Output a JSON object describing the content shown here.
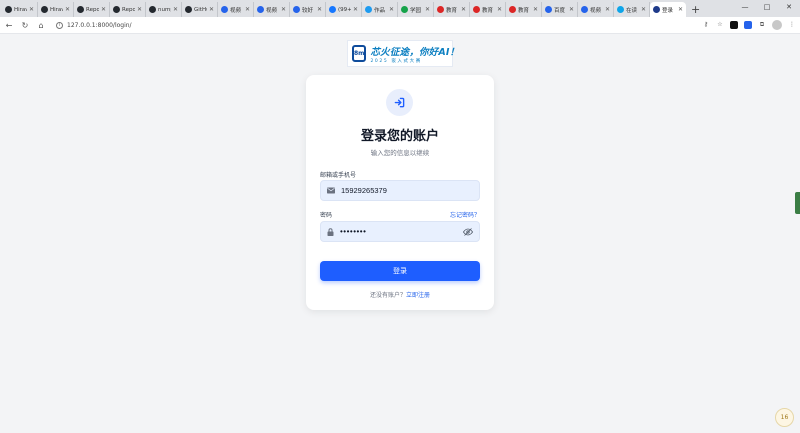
{
  "browser": {
    "tabs": [
      {
        "title": "Hirav",
        "color": "#24292f"
      },
      {
        "title": "Hirav",
        "color": "#24292f"
      },
      {
        "title": "Repo",
        "color": "#24292f"
      },
      {
        "title": "Repo",
        "color": "#24292f"
      },
      {
        "title": "nump",
        "color": "#24292f"
      },
      {
        "title": "GitHu",
        "color": "#24292f"
      },
      {
        "title": "视频",
        "color": "#2563eb"
      },
      {
        "title": "视频",
        "color": "#2563eb"
      },
      {
        "title": "较好",
        "color": "#2563eb"
      },
      {
        "title": "(99+",
        "color": "#1677ff"
      },
      {
        "title": "作品",
        "color": "#1d9bf0"
      },
      {
        "title": "学园",
        "color": "#16a34a"
      },
      {
        "title": "教育",
        "color": "#dc2626"
      },
      {
        "title": "教育",
        "color": "#dc2626"
      },
      {
        "title": "教育",
        "color": "#dc2626"
      },
      {
        "title": "百度",
        "color": "#2563eb"
      },
      {
        "title": "视频",
        "color": "#2563eb"
      },
      {
        "title": "在读",
        "color": "#0ea5e9"
      },
      {
        "title": "登录",
        "color": "#1e3a8a",
        "active": true
      }
    ],
    "new_tab": "+",
    "url": "127.0.0.1:8000/login/",
    "window_controls": {
      "minimize": "—",
      "maximize": "□",
      "close": "✕"
    }
  },
  "logo": {
    "chip_text": "8m",
    "main_text": "芯火征途，你好AI！",
    "sub_text": "2025 嵌入式大赛"
  },
  "login": {
    "title": "登录您的账户",
    "subtitle": "输入您的信息以继续",
    "email_label": "邮箱或手机号",
    "email_value": "15929265379",
    "password_label": "密码",
    "forgot_link": "忘记密码？",
    "password_value": "••••••••",
    "submit_label": "登录",
    "footer_text": "还没有账户？",
    "register_link": "立即注册"
  },
  "floating_widget": "16",
  "colors": {
    "primary": "#1e5eff",
    "link": "#2563eb",
    "field_bg": "#e8f0fe"
  }
}
